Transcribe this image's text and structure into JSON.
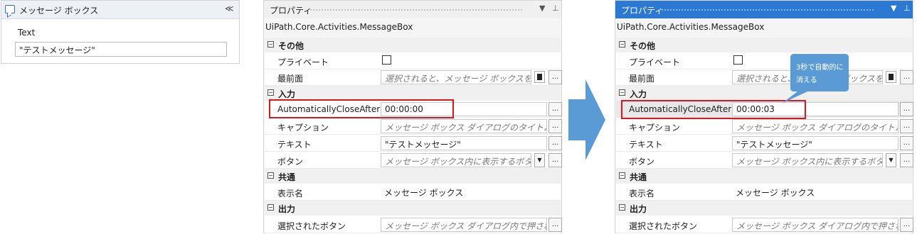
{
  "activity_card": {
    "title": "メッセージ ボックス",
    "field_label": "Text",
    "field_value": "\"テストメッセージ\""
  },
  "panel_before": {
    "header_title": "プロパティ",
    "class_name": "UiPath.Core.Activities.MessageBox",
    "categories": {
      "misc": "その他",
      "input": "入力",
      "common": "共通",
      "output": "出力"
    },
    "rows": {
      "private_label": "プライベート",
      "topmost_label": "最前面",
      "topmost_placeholder": "選択されると、メッセージ ボックスを常に前面",
      "auto_close_label": "AutomaticallyCloseAfter",
      "auto_close_value": "00:00:00",
      "caption_label": "キャプション",
      "caption_placeholder": "メッセージ ボックス ダイアログのタイトルです。",
      "text_label": "テキスト",
      "text_value": "\"テストメッセージ\"",
      "buttons_label": "ボタン",
      "buttons_placeholder": "メッセージ ボックス内に表示するボタンを指定",
      "display_name_label": "表示名",
      "display_name_value": "メッセージ ボックス",
      "chosen_button_label": "選択されたボタン",
      "chosen_button_placeholder": "メッセージ ボックス ダイアログ内で押されたボタン"
    }
  },
  "panel_after": {
    "header_title": "プロパティ",
    "class_name": "UiPath.Core.Activities.MessageBox",
    "categories": {
      "misc": "その他",
      "input": "入力",
      "common": "共通",
      "output": "出力"
    },
    "rows": {
      "private_label": "プライベート",
      "topmost_label": "最前面",
      "topmost_placeholder": "選択されると、メッセージ ボックスを常に前面",
      "auto_close_label": "AutomaticallyCloseAfter",
      "auto_close_value": "00:00:03",
      "caption_label": "キャプション",
      "caption_placeholder": "メッセージ ボックス ダイアログのタイトルです。",
      "text_label": "テキスト",
      "text_value": "\"テストメッセージ\"",
      "buttons_label": "ボタン",
      "buttons_placeholder": "メッセージ ボックス内に表示するボタンを指定",
      "display_name_label": "表示名",
      "display_name_value": "メッセージ ボックス",
      "chosen_button_label": "選択されたボタン",
      "chosen_button_placeholder": "メッセージ ボックス ダイアログ内で押されたボタン"
    }
  },
  "callout": {
    "text": "3秒で自動的に消える"
  },
  "glyphs": {
    "collapse": "≪",
    "ellipsis": "...",
    "dropdown": "▼",
    "pin": "⊥",
    "header_menu": "▼",
    "category_toggle": "−"
  },
  "colors": {
    "highlight": "#e0161f",
    "arrow": "#5b9bd5",
    "active_header": "#2b79d3",
    "callout": "#5b9bd5"
  }
}
